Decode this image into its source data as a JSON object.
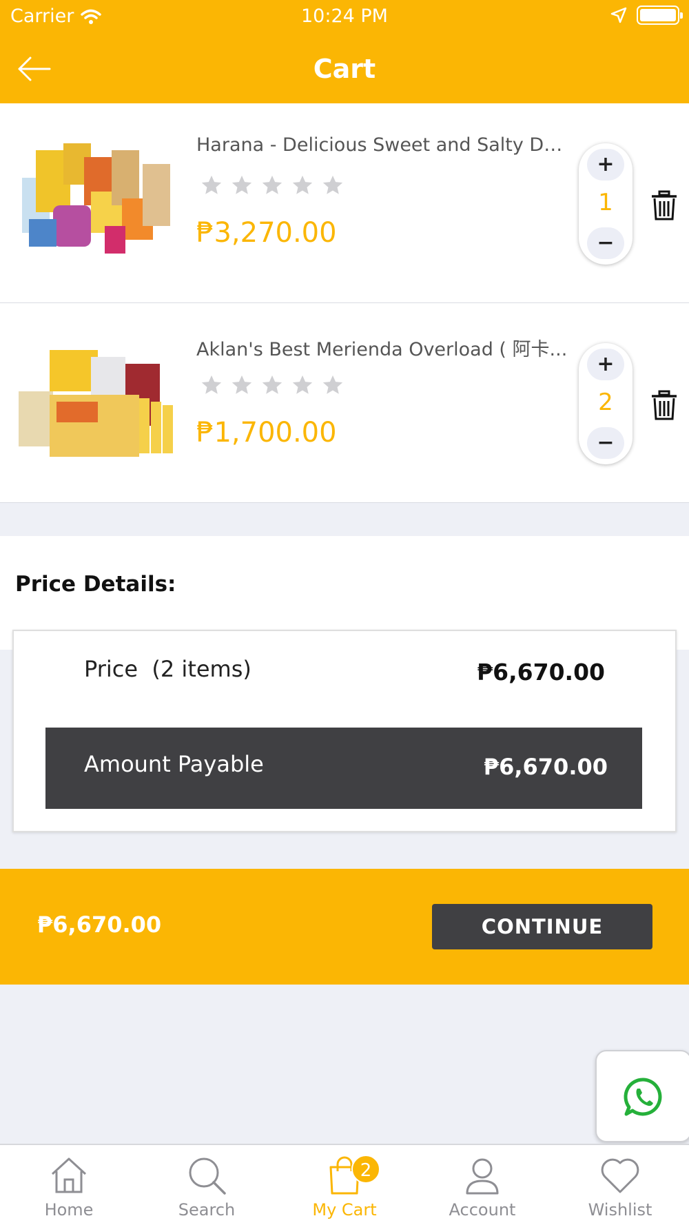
{
  "status_bar": {
    "carrier": "Carrier",
    "time": "10:24 PM"
  },
  "header": {
    "title": "Cart"
  },
  "cart_items": [
    {
      "name": "Harana - Delicious Sweet and Salty Deli...",
      "price": "₱3,270.00",
      "quantity": "1",
      "rating": 0,
      "rating_max": 5
    },
    {
      "name": "Aklan's Best Merienda Overload ( 阿卡...",
      "price": "₱1,700.00",
      "quantity": "2",
      "rating": 0,
      "rating_max": 5
    }
  ],
  "quantity_controls": {
    "plus": "+",
    "minus": "−"
  },
  "price_details": {
    "heading": "Price Details:",
    "price_label": "Price",
    "items_count": "(2 items)",
    "price_value": "₱6,670.00",
    "payable_label": "Amount Payable",
    "payable_value": "₱6,670.00"
  },
  "checkout": {
    "total": "₱6,670.00",
    "continue_label": "CONTINUE"
  },
  "tabbar": {
    "home": "Home",
    "search": "Search",
    "cart": "My Cart",
    "cart_badge": "2",
    "account": "Account",
    "wishlist": "Wishlist"
  },
  "colors": {
    "accent": "#fbb604",
    "dark": "#404043",
    "whatsapp": "#25b03a"
  },
  "icons": [
    "back-arrow-icon",
    "wifi-icon",
    "location-arrow-icon",
    "battery-icon",
    "star-icon",
    "trash-icon",
    "whatsapp-icon",
    "home-icon",
    "search-icon",
    "cart-bag-icon",
    "account-icon",
    "heart-icon"
  ]
}
